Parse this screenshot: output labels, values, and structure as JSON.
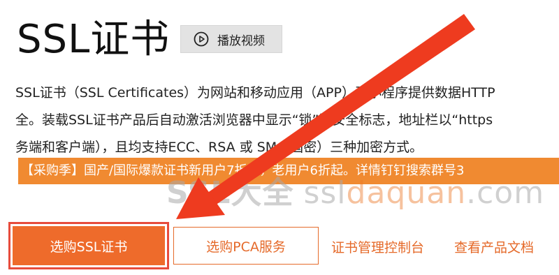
{
  "header": {
    "title": "SSL证书",
    "play_button": {
      "label": "播放视频",
      "icon": "play-circle-icon"
    }
  },
  "description": {
    "line1": "SSL证书（SSL Certificates）为网站和移动应用（APP）及小程序提供数据HTTP",
    "line2": "全。装载SSL证书产品后自动激活浏览器中显示“锁”型安全标志，地址栏以“https",
    "line3": "务端和客户端），且均支持ECC、RSA 或 SM（国密）三种加密方式。"
  },
  "promo_banner": {
    "text": "【采购季】国产/国际爆款证书新用户7折起，老用户6折起。详情钉钉搜索群号3"
  },
  "watermark": {
    "brand": "SSL大全",
    "domain_prefix": "ssl",
    "domain_accent": "daquan",
    "domain_suffix": ".com"
  },
  "actions": {
    "primary_label": "选购SSL证书",
    "secondary_label": "选购PCA服务",
    "console_link": "证书管理控制台",
    "docs_link": "查看产品文档"
  },
  "colors": {
    "accent": "#ee6b2b",
    "banner": "#f08a31",
    "highlight_box": "#e74c3c",
    "arrow": "#ee3b1f"
  }
}
